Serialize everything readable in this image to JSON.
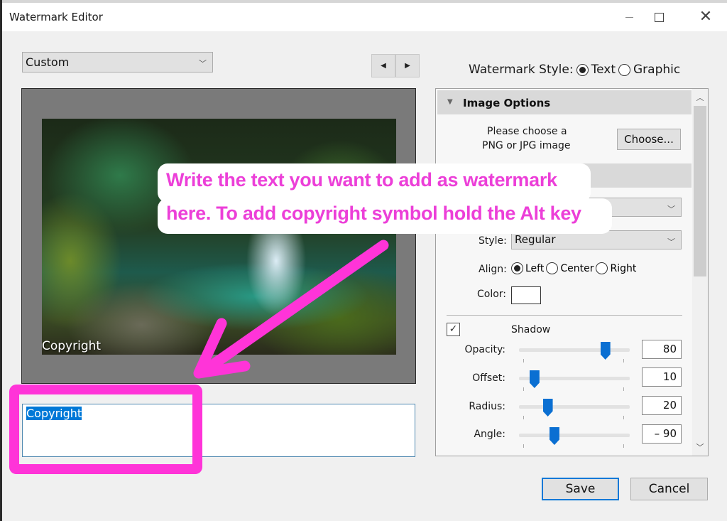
{
  "window": {
    "title": "Watermark Editor",
    "controls": {
      "minimize": "minimize-icon",
      "maximize": "maximize-icon",
      "close": "close-icon"
    }
  },
  "preset": {
    "selected": "Custom"
  },
  "nav": {
    "prev": "◀",
    "next": "▶"
  },
  "watermark_style": {
    "label": "Watermark Style:",
    "options": [
      {
        "label": "Text",
        "selected": true
      },
      {
        "label": "Graphic",
        "selected": false
      }
    ]
  },
  "preview": {
    "watermark_text": "Copyright"
  },
  "text_input": {
    "value": "Copyright"
  },
  "panel": {
    "image_options": {
      "header": "Image Options",
      "hint_line1": "Please choose a",
      "hint_line2": "PNG or JPG image",
      "choose_label": "Choose..."
    },
    "text_options": {
      "font_value": "",
      "style_label": "Style:",
      "style_value": "Regular",
      "align_label": "Align:",
      "align_options": [
        {
          "label": "Left",
          "selected": true
        },
        {
          "label": "Center",
          "selected": false
        },
        {
          "label": "Right",
          "selected": false
        }
      ],
      "color_label": "Color:",
      "color_value": "#ffffff"
    },
    "shadow": {
      "enabled": true,
      "label": "Shadow",
      "sliders": [
        {
          "label": "Opacity:",
          "value": "80",
          "fraction": 0.78
        },
        {
          "label": "Offset:",
          "value": "10",
          "fraction": 0.14
        },
        {
          "label": "Radius:",
          "value": "20",
          "fraction": 0.26
        },
        {
          "label": "Angle:",
          "value": "– 90",
          "fraction": 0.32
        }
      ]
    }
  },
  "footer": {
    "save": "Save",
    "cancel": "Cancel"
  },
  "annotation": {
    "line1": "Write the text you want to add as watermark",
    "line2": "here. To add copyright symbol hold the Alt key",
    "color": "#ec3fd8"
  }
}
